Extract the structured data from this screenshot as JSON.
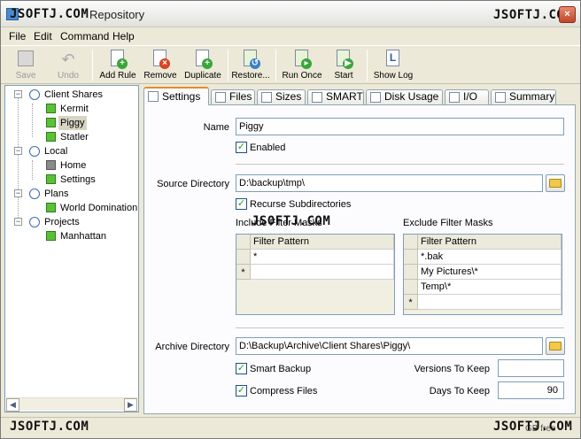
{
  "window": {
    "title": "Repository",
    "watermark": "JSOFTJ.COM",
    "controls": {
      "minimize": "_",
      "maximize": "□",
      "close": "×"
    }
  },
  "menu": [
    "File",
    "Edit",
    "Command",
    "Help"
  ],
  "toolbar": {
    "save": "Save",
    "undo": "Undo",
    "add_rule": "Add Rule",
    "remove": "Remove",
    "duplicate": "Duplicate",
    "restore": "Restore...",
    "run_once": "Run Once",
    "start": "Start",
    "show_log": "Show Log"
  },
  "tree": {
    "groups": [
      {
        "label": "Client Shares",
        "children": [
          "Kermit",
          "Piggy",
          "Statler"
        ]
      },
      {
        "label": "Local",
        "children": [
          "Home",
          "Settings"
        ]
      },
      {
        "label": "Plans",
        "children": [
          "World Domination"
        ]
      },
      {
        "label": "Projects",
        "children": [
          "Manhattan"
        ]
      }
    ],
    "selected": "Piggy"
  },
  "tabs": [
    "Settings",
    "Files",
    "Sizes",
    "SMART",
    "Disk Usage",
    "I/O",
    "Summary"
  ],
  "settings": {
    "name_label": "Name",
    "name_value": "Piggy",
    "enabled_label": "Enabled",
    "source_label": "Source Directory",
    "source_value": "D:\\backup\\tmp\\",
    "recurse_label": "Recurse Subdirectories",
    "include_label": "Include Filter Masks",
    "exclude_label": "Exclude Filter Masks",
    "filter_header": "Filter Pattern",
    "include_rows": [
      "*",
      ""
    ],
    "exclude_rows": [
      "*.bak",
      "My Pictures\\*",
      "Temp\\*",
      ""
    ],
    "new_row_marker": "*",
    "archive_label": "Archive Directory",
    "archive_value": "D:\\Backup\\Archive\\Client Shares\\Piggy\\",
    "smart_backup_label": "Smart Backup",
    "versions_label": "Versions To Keep",
    "versions_value": "",
    "compress_label": "Compress Files",
    "days_label": "Days To Keep",
    "days_value": "90"
  },
  "status": {
    "watermark": "JSOFTJ.COM",
    "free_text": "GB free"
  },
  "colors": {
    "accent_tab": "#e68b2c",
    "node_green": "#59c136",
    "node_grey": "#8a8a8a"
  }
}
